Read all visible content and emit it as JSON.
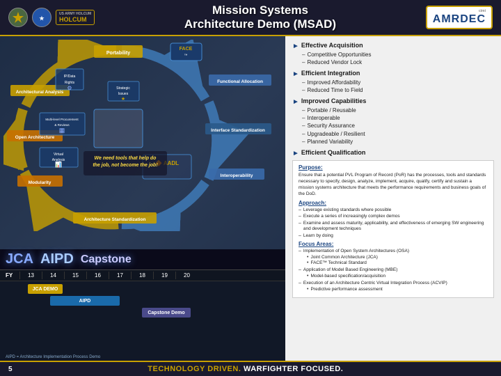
{
  "header": {
    "title_line1": "Mission Systems",
    "title_line2": "Architecture Demo (MSAD)",
    "amrdec_label": "AMRDEC",
    "holcum_label": "US ARMY HOLCUM"
  },
  "bullets": {
    "effective_acquisition": {
      "title": "Effective Acquisition",
      "items": [
        "Competitive Opportunities",
        "Reduced Vendor Lock"
      ]
    },
    "efficient_integration": {
      "title": "Efficient Integration",
      "items": [
        "Improved Affordability",
        "Reduced Time to Field"
      ]
    },
    "improved_capabilities": {
      "title": "Improved Capabilities",
      "items": [
        "Portable / Reusable",
        "Interoperable",
        "Security Assurance",
        "Upgradeable / Resilient",
        "Planned Variability"
      ]
    },
    "efficient_qualification": {
      "title": "Efficient Qualification"
    }
  },
  "purpose": {
    "title": "Purpose:",
    "text": "Ensure that a potential PVL Program of Record (PoR) has the processes, tools and standards necessary to specify, design, analyze, implement, acquire, qualify, certify and sustain a mission systems architecture that meets the performance requirements and business goals of the DoD."
  },
  "approach": {
    "title": "Approach:",
    "items": [
      "Leverage existing standards where possible",
      "Execute a series of increasingly complex demos",
      "Examine and assess maturity, applicability, and effectiveness of emerging SW engineering and development techniques",
      "Learn by doing"
    ]
  },
  "focus_areas": {
    "title": "Focus Areas:",
    "items": [
      {
        "main": "Implementation of Open System Architectures (OSA)",
        "subs": [
          "Joint Common Architecture (JCA)",
          "FACE™ Technical Standard"
        ]
      },
      {
        "main": "Application of Model Based Engineering (MBE)",
        "subs": [
          "Model-based specification/acquisition"
        ]
      },
      {
        "main": "Execution of an Architecture Centric Virtual Integration Process (ACVIP)",
        "subs": [
          "Predictive performance assessment"
        ]
      }
    ]
  },
  "timeline": {
    "big_labels": [
      "JCA",
      "AIPD",
      "Capstone"
    ],
    "fy_label": "FY",
    "years": [
      "13",
      "14",
      "15",
      "16",
      "17",
      "18",
      "19",
      "20"
    ],
    "bars": [
      {
        "label": "JCA DEMO",
        "color": "#c8a000"
      },
      {
        "label": "AIPD",
        "color": "#1a6aaa"
      },
      {
        "label": "Capstone Demo",
        "color": "#5a5a9a"
      }
    ],
    "note": "AIPD = Architecture Implementation Process Demo"
  },
  "diagram": {
    "labels": [
      "Portability",
      "Functional Allocation",
      "Interface Standardization",
      "Interoperability",
      "Architecture Standardization",
      "Modularity",
      "Open Architecture",
      "Architectural Analysis"
    ],
    "center_text": "We need tools that help do the job, not become the job!",
    "icon_labels": [
      "IP/Data Rights",
      "Strategic Issues",
      "Multi-level Procurement & Reviews",
      "Virtual Analysis"
    ]
  },
  "footer": {
    "page_number": "5",
    "tagline_part1": "TECHNOLOGY DRIVEN.",
    "tagline_part2": "WARFIGHTER FOCUSED."
  }
}
